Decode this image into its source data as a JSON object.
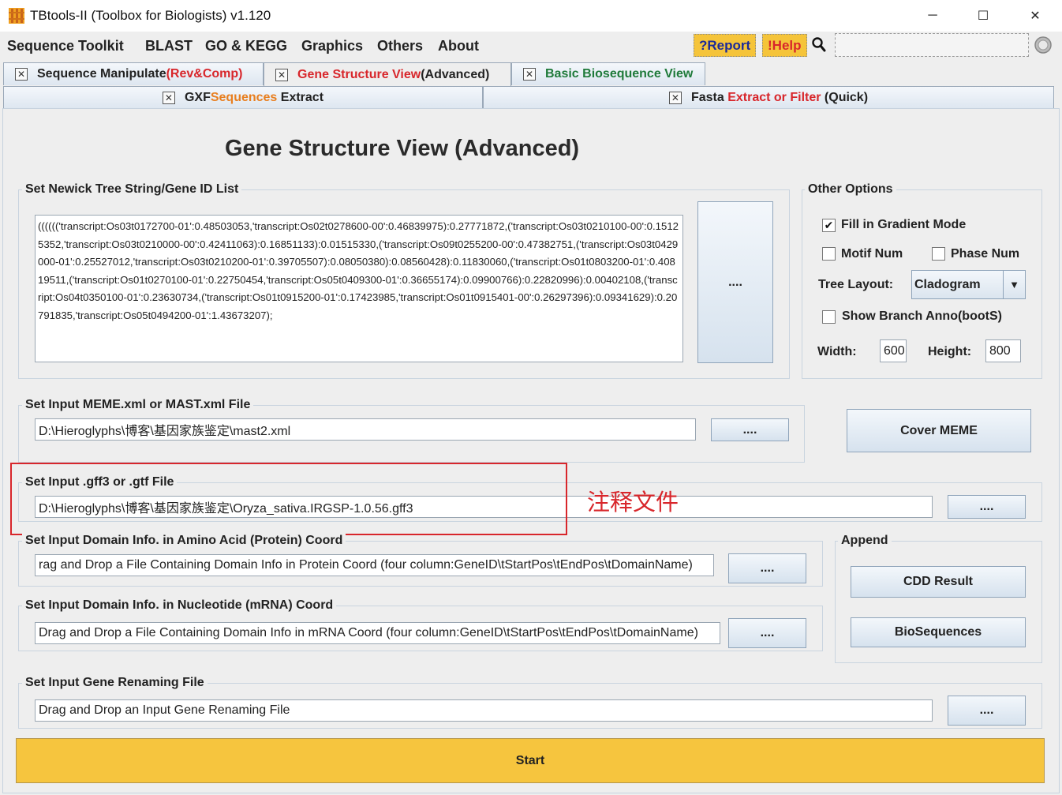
{
  "window": {
    "title": "TBtools-II (Toolbox for Biologists) v1.120",
    "minimize_icon": "minimize-icon",
    "maximize_icon": "maximize-icon",
    "close_icon": "close-icon",
    "min_glyph": "─",
    "max_glyph": "☐",
    "close_glyph": "✕"
  },
  "menu": {
    "items": [
      "Sequence Toolkit",
      "BLAST",
      "GO & KEGG",
      "Graphics",
      "Others",
      "About"
    ],
    "report_label": "?Report",
    "help_label": "!Help",
    "search_icon": "search-icon",
    "search_glyph": "🔍",
    "spinner_icon": "spinner-icon"
  },
  "tabs": {
    "row1": [
      {
        "plain": "Sequence Manipulate ",
        "colored": "(Rev&Comp)",
        "colored_color": "#d8262b"
      },
      {
        "plain": "Gene Structure View",
        "suffix": " (Advanced)",
        "plain_color": "#d8262b",
        "suffix_color": "#222222",
        "active": true
      },
      {
        "plain": "Basic Biosequence View",
        "plain_color": "#1f7a3a"
      }
    ],
    "row2": [
      {
        "pre": "GXF ",
        "colored": "Sequences",
        "post": " Extract",
        "colored_color": "#e87f20"
      },
      {
        "pre": "Fasta ",
        "colored": "Extract or Filter",
        "post": " (Quick)",
        "colored_color": "#d8262b"
      }
    ],
    "close_glyph": "✕"
  },
  "page": {
    "title": "Gene Structure View (Advanced)"
  },
  "newick": {
    "label": "Set Newick Tree String/Gene ID List",
    "value": "(((((('transcript:Os03t0172700-01':0.48503053,'transcript:Os02t0278600-00':0.46839975):0.27771872,('transcript:Os03t0210100-00':0.15125352,'transcript:Os03t0210000-00':0.42411063):0.16851133):0.01515330,('transcript:Os09t0255200-00':0.47382751,('transcript:Os03t0429000-01':0.25527012,'transcript:Os03t0210200-01':0.39705507):0.08050380):0.08560428):0.11830060,('transcript:Os01t0803200-01':0.40819511,('transcript:Os01t0270100-01':0.22750454,'transcript:Os05t0409300-01':0.36655174):0.09900766):0.22820996):0.00402108,('transcript:Os04t0350100-01':0.23630734,('transcript:Os01t0915200-01':0.17423985,'transcript:Os01t0915401-00':0.26297396):0.09341629):0.20791835,'transcript:Os05t0494200-01':1.43673207);",
    "browse_label": "...."
  },
  "options": {
    "label": "Other Options",
    "fill_gradient": {
      "label": "Fill in Gradient Mode",
      "checked": true
    },
    "motif_num": {
      "label": "Motif Num",
      "checked": false
    },
    "phase_num": {
      "label": "Phase Num",
      "checked": false
    },
    "tree_layout_label": "Tree Layout:",
    "tree_layout_value": "Cladogram",
    "show_branch": {
      "label": "Show Branch Anno(bootS)",
      "checked": false
    },
    "width_label": "Width:",
    "width_value": "600",
    "height_label": "Height:",
    "height_value": "800",
    "check_glyph": "✔",
    "dropdown_glyph": "▼"
  },
  "meme": {
    "label": "Set Input MEME.xml or MAST.xml File",
    "value": "D:\\Hieroglyphs\\博客\\基因家族鉴定\\mast2.xml",
    "browse_label": "....",
    "cover_label": "Cover MEME"
  },
  "gff": {
    "label": "Set Input .gff3 or .gtf File",
    "value": "D:\\Hieroglyphs\\博客\\基因家族鉴定\\Oryza_sativa.IRGSP-1.0.56.gff3",
    "browse_label": "....",
    "annotation": "注释文件",
    "highlight_color": "#d8262b"
  },
  "domain_protein": {
    "label": "Set Input Domain Info. in Amino Acid (Protein) Coord",
    "value": "rag and Drop a File Containing Domain Info in Protein Coord (four column:GeneID\\tStartPos\\tEndPos\\tDomainName)",
    "browse_label": "...."
  },
  "domain_mrna": {
    "label": "Set Input Domain Info. in Nucleotide (mRNA) Coord",
    "value": "Drag and Drop a File Containing Domain Info in mRNA Coord (four column:GeneID\\tStartPos\\tEndPos\\tDomainName)",
    "browse_label": "...."
  },
  "append": {
    "label": "Append",
    "cdd_label": "CDD Result",
    "bioseq_label": "BioSequences"
  },
  "renaming": {
    "label": "Set Input Gene Renaming File",
    "value": "Drag and Drop an Input Gene Renaming File",
    "browse_label": "...."
  },
  "start_label": "Start",
  "colors": {
    "accent_yellow": "#f6c53e",
    "tab_red": "#d8262b",
    "tab_green": "#1f7a3a",
    "tab_orange": "#e87f20"
  }
}
